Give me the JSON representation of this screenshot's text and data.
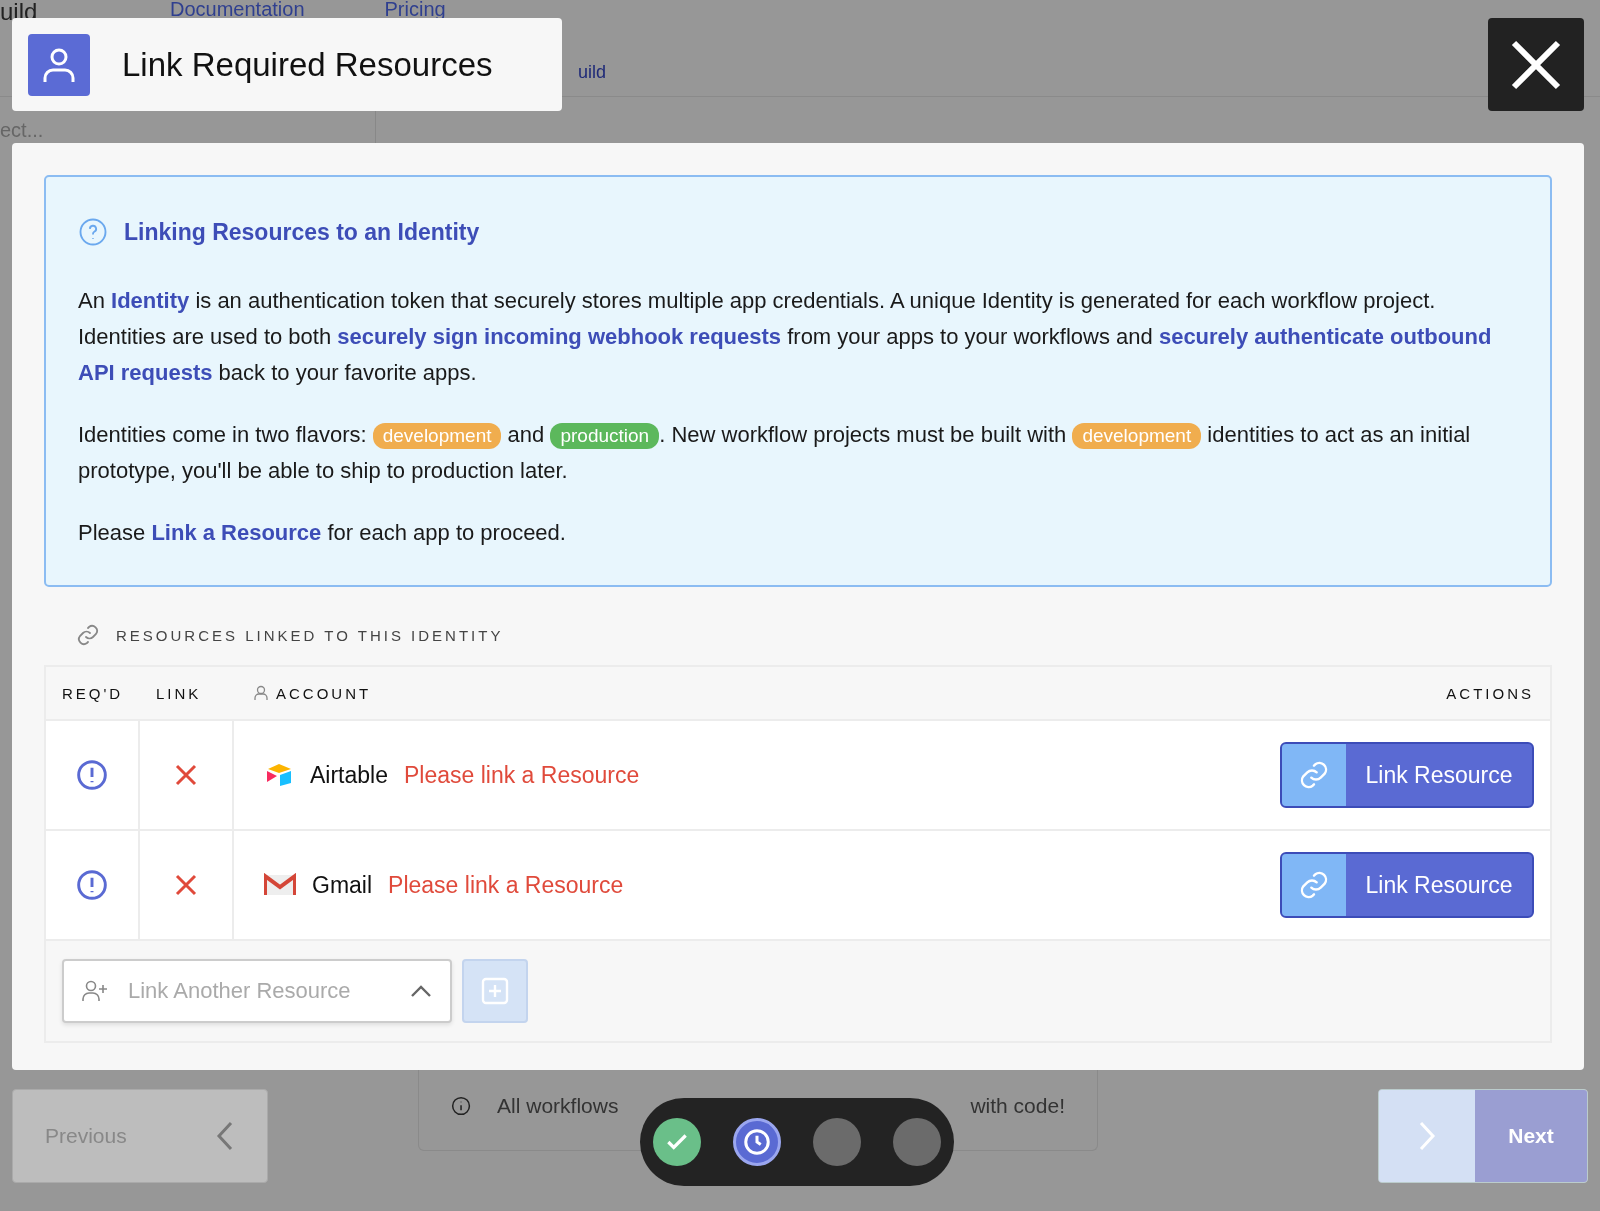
{
  "background_page": {
    "brand_fragment": "uild",
    "nav_links": [
      "Documentation",
      "Pricing"
    ],
    "tab_fragment": "uild",
    "search_fragment": "ect...",
    "footer_note": [
      "All workflows",
      "with code!"
    ],
    "previous_button": "Previous",
    "next_button": "Next"
  },
  "modal": {
    "title": "Link Required Resources",
    "info": {
      "heading": "Linking Resources to an Identity",
      "paragraphs": [
        [
          {
            "kind": "text",
            "text": "An **Identity** is an authentication token that securely stores multiple app credentials. A unique Identity is generated for each workflow project. Identities are used to both **securely sign incoming webhook requests** from your apps to your workflows and **securely authenticate outbound API requests** back to your favorite apps."
          }
        ],
        [
          {
            "kind": "text",
            "text": "Identities come in two flavors: "
          },
          {
            "kind": "tag",
            "text": "development",
            "color": "#f0ad4e"
          },
          {
            "kind": "text",
            "text": " and "
          },
          {
            "kind": "tag",
            "text": "production",
            "color": "#5cb85c"
          },
          {
            "kind": "text",
            "text": ". New workflow projects must be built with "
          },
          {
            "kind": "tag",
            "text": "development",
            "color": "#f0ad4e"
          },
          {
            "kind": "text",
            "text": " identities to act as an initial prototype, you'll be able to ship to production later."
          }
        ],
        [
          {
            "kind": "text",
            "text": "Please **Link a Resource** for each app to proceed."
          }
        ]
      ]
    },
    "section_title": "RESOURCES LINKED TO THIS IDENTITY",
    "columns": [
      "REQ'D",
      "LINK",
      "ACCOUNT",
      "ACTIONS"
    ],
    "rows": [
      {
        "kind": "airtable",
        "app": "Airtable",
        "required": true,
        "linked": false,
        "status": "Please link a Resource",
        "action": "Link Resource"
      },
      {
        "kind": "gmail",
        "app": "Gmail",
        "required": true,
        "linked": false,
        "status": "Please link a Resource",
        "action": "Link Resource"
      }
    ],
    "add_resource": {
      "placeholder": "Link Another Resource"
    }
  },
  "stepper": [
    {
      "done": true,
      "selected": false
    },
    {
      "done": false,
      "selected": true
    },
    {
      "done": false,
      "selected": false
    },
    {
      "done": false,
      "selected": false
    }
  ]
}
